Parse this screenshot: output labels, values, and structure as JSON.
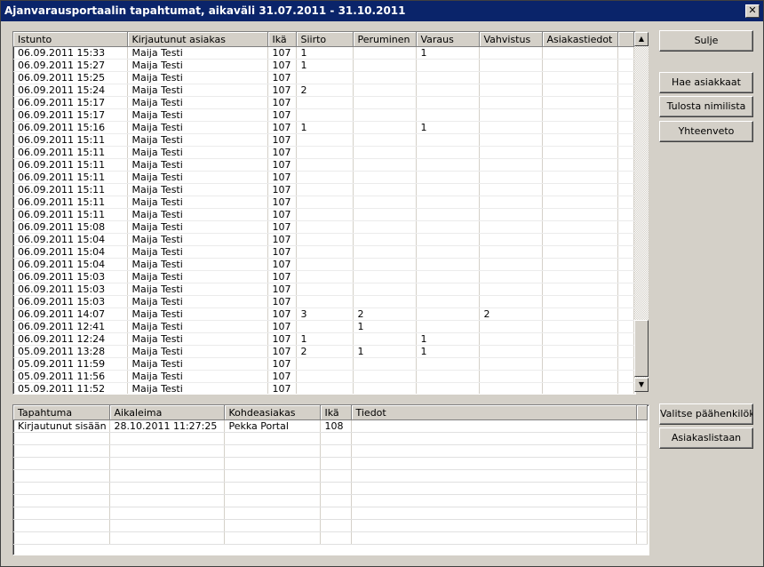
{
  "window": {
    "title": "Ajanvarausportaalin tapahtumat, aikaväli 31.07.2011 - 31.10.2011",
    "close_glyph": "✕"
  },
  "sessions": {
    "columns": [
      "Istunto",
      "Kirjautunut asiakas",
      "Ikä",
      "Siirto",
      "Peruminen",
      "Varaus",
      "Vahvistus",
      "Asiakastiedot"
    ],
    "rows": [
      [
        "06.09.2011 15:33",
        "Maija Testi",
        "107",
        "1",
        "",
        "1",
        "",
        ""
      ],
      [
        "06.09.2011 15:27",
        "Maija Testi",
        "107",
        "1",
        "",
        "",
        "",
        ""
      ],
      [
        "06.09.2011 15:25",
        "Maija Testi",
        "107",
        "",
        "",
        "",
        "",
        ""
      ],
      [
        "06.09.2011 15:24",
        "Maija Testi",
        "107",
        "2",
        "",
        "",
        "",
        ""
      ],
      [
        "06.09.2011 15:17",
        "Maija Testi",
        "107",
        "",
        "",
        "",
        "",
        ""
      ],
      [
        "06.09.2011 15:17",
        "Maija Testi",
        "107",
        "",
        "",
        "",
        "",
        ""
      ],
      [
        "06.09.2011 15:16",
        "Maija Testi",
        "107",
        "1",
        "",
        "1",
        "",
        ""
      ],
      [
        "06.09.2011 15:11",
        "Maija Testi",
        "107",
        "",
        "",
        "",
        "",
        ""
      ],
      [
        "06.09.2011 15:11",
        "Maija Testi",
        "107",
        "",
        "",
        "",
        "",
        ""
      ],
      [
        "06.09.2011 15:11",
        "Maija Testi",
        "107",
        "",
        "",
        "",
        "",
        ""
      ],
      [
        "06.09.2011 15:11",
        "Maija Testi",
        "107",
        "",
        "",
        "",
        "",
        ""
      ],
      [
        "06.09.2011 15:11",
        "Maija Testi",
        "107",
        "",
        "",
        "",
        "",
        ""
      ],
      [
        "06.09.2011 15:11",
        "Maija Testi",
        "107",
        "",
        "",
        "",
        "",
        ""
      ],
      [
        "06.09.2011 15:11",
        "Maija Testi",
        "107",
        "",
        "",
        "",
        "",
        ""
      ],
      [
        "06.09.2011 15:08",
        "Maija Testi",
        "107",
        "",
        "",
        "",
        "",
        ""
      ],
      [
        "06.09.2011 15:04",
        "Maija Testi",
        "107",
        "",
        "",
        "",
        "",
        ""
      ],
      [
        "06.09.2011 15:04",
        "Maija Testi",
        "107",
        "",
        "",
        "",
        "",
        ""
      ],
      [
        "06.09.2011 15:04",
        "Maija Testi",
        "107",
        "",
        "",
        "",
        "",
        ""
      ],
      [
        "06.09.2011 15:03",
        "Maija Testi",
        "107",
        "",
        "",
        "",
        "",
        ""
      ],
      [
        "06.09.2011 15:03",
        "Maija Testi",
        "107",
        "",
        "",
        "",
        "",
        ""
      ],
      [
        "06.09.2011 15:03",
        "Maija Testi",
        "107",
        "",
        "",
        "",
        "",
        ""
      ],
      [
        "06.09.2011 14:07",
        "Maija Testi",
        "107",
        "3",
        "2",
        "",
        "2",
        ""
      ],
      [
        "06.09.2011 12:41",
        "Maija Testi",
        "107",
        "",
        "1",
        "",
        "",
        ""
      ],
      [
        "06.09.2011 12:24",
        "Maija Testi",
        "107",
        "1",
        "",
        "1",
        "",
        ""
      ],
      [
        "05.09.2011 13:28",
        "Maija Testi",
        "107",
        "2",
        "1",
        "1",
        "",
        ""
      ],
      [
        "05.09.2011 11:59",
        "Maija Testi",
        "107",
        "",
        "",
        "",
        "",
        ""
      ],
      [
        "05.09.2011 11:56",
        "Maija Testi",
        "107",
        "",
        "",
        "",
        "",
        ""
      ],
      [
        "05.09.2011 11:52",
        "Maija Testi",
        "107",
        "",
        "",
        "",
        "",
        ""
      ]
    ]
  },
  "events": {
    "columns": [
      "Tapahtuma",
      "Aikaleima",
      "Kohdeasiakas",
      "Ikä",
      "Tiedot"
    ],
    "rows": [
      [
        "Kirjautunut sisään",
        "28.10.2011 11:27:25",
        "Pekka Portal",
        "108",
        ""
      ]
    ],
    "empty_rows": 9
  },
  "scrollbar": {
    "up_glyph": "▲",
    "down_glyph": "▼"
  },
  "buttons": {
    "close": "Sulje",
    "fetch_customers": "Hae asiakkaat",
    "print_names": "Tulosta nimilista",
    "summary": "Yhteenveto",
    "select_main": "Valitse päähenkilöksi",
    "to_customer_list": "Asiakaslistaan"
  }
}
